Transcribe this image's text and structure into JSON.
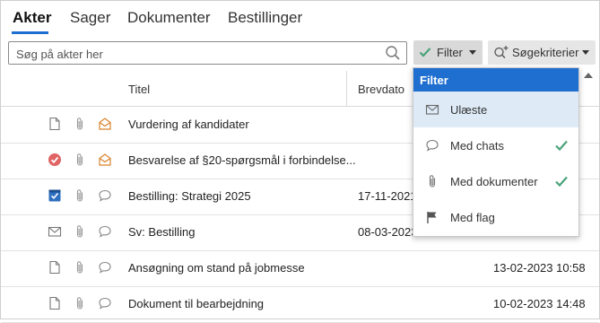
{
  "tabs": [
    {
      "label": "Akter",
      "active": true
    },
    {
      "label": "Sager"
    },
    {
      "label": "Dokumenter"
    },
    {
      "label": "Bestillinger"
    }
  ],
  "search": {
    "placeholder": "Søg på akter her",
    "icon": "magnifier-icon"
  },
  "toolbar": {
    "filter_label": "Filter",
    "sogekriterier_label": "Søgekriterier"
  },
  "table": {
    "headers": {
      "title": "Titel",
      "date": "Brevdato"
    },
    "rows": [
      {
        "icon1": "document-icon",
        "icon2": "paperclip-icon",
        "icon3": "open-envelope-icon",
        "title": "Vurdering af kandidater",
        "date": "",
        "date2": ""
      },
      {
        "icon1": "red-check-icon",
        "icon2": "paperclip-icon",
        "icon3": "open-envelope-icon",
        "title": "Besvarelse af §20-spørgsmål i forbindelse...",
        "date": "",
        "date2": ""
      },
      {
        "icon1": "blue-task-icon",
        "icon2": "paperclip-icon",
        "icon3": "chat-bubble-icon",
        "title": "Bestilling: Strategi 2025",
        "date": "17-11-2021",
        "date2": ""
      },
      {
        "icon1": "envelope-icon",
        "icon2": "paperclip-icon",
        "icon3": "chat-bubble-icon",
        "title": "Sv: Bestilling",
        "date": "08-03-2023",
        "date2": ""
      },
      {
        "icon1": "document-icon",
        "icon2": "paperclip-icon",
        "icon3": "chat-bubble-icon",
        "title": "Ansøgning om stand på jobmesse",
        "date": "",
        "date2": "13-02-2023 10:58"
      },
      {
        "icon1": "document-icon",
        "icon2": "paperclip-icon",
        "icon3": "chat-bubble-icon",
        "title": "Dokument til bearbejdning",
        "date": "",
        "date2": "10-02-2023 14:48"
      }
    ]
  },
  "filter_menu": {
    "header": "Filter",
    "items": [
      {
        "label": "Ulæste",
        "icon": "envelope-icon",
        "checked": false,
        "selected": true
      },
      {
        "label": "Med chats",
        "icon": "chat-bubble-icon",
        "checked": true
      },
      {
        "label": "Med dokumenter",
        "icon": "paperclip-icon",
        "checked": true
      },
      {
        "label": "Med flag",
        "icon": "flag-icon",
        "checked": false
      }
    ]
  },
  "colors": {
    "accent": "#1f6fd1",
    "check_green": "#4aa37a",
    "orange": "#d9822b",
    "red": "#d9534f"
  }
}
